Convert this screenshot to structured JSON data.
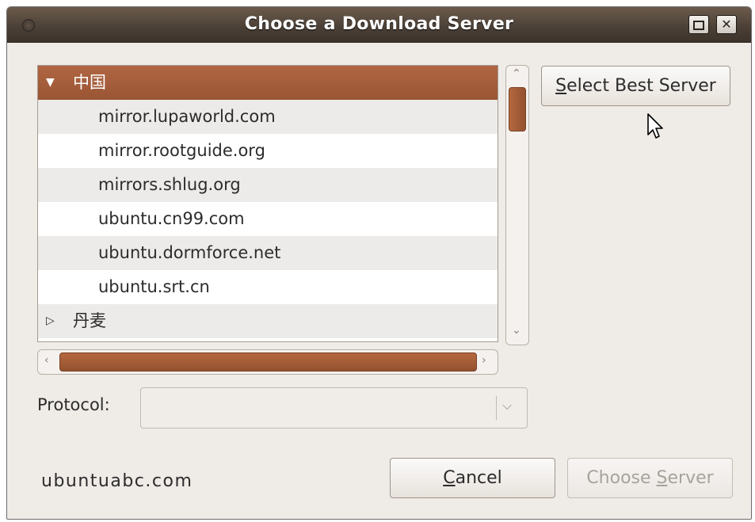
{
  "window": {
    "title": "Choose a Download Server"
  },
  "server_list": {
    "groups": [
      {
        "name": "中国",
        "expanded": true,
        "servers": [
          "mirror.lupaworld.com",
          "mirror.rootguide.org",
          "mirrors.shlug.org",
          "ubuntu.cn99.com",
          "ubuntu.dormforce.net",
          "ubuntu.srt.cn"
        ]
      },
      {
        "name": "丹麦",
        "expanded": false,
        "servers": []
      }
    ]
  },
  "buttons": {
    "select_best": {
      "prefix": "S",
      "rest": "elect Best Server"
    },
    "cancel": {
      "prefix": "C",
      "rest": "ancel"
    },
    "choose": {
      "before": "Choose ",
      "mnemonic": "S",
      "after": "erver",
      "enabled": false
    }
  },
  "protocol": {
    "label": "Protocol:",
    "value": ""
  },
  "footer": {
    "text": "ubuntuabc.com"
  },
  "colors": {
    "selection": "#a65d3b",
    "titlebar": "#4a3f36"
  }
}
